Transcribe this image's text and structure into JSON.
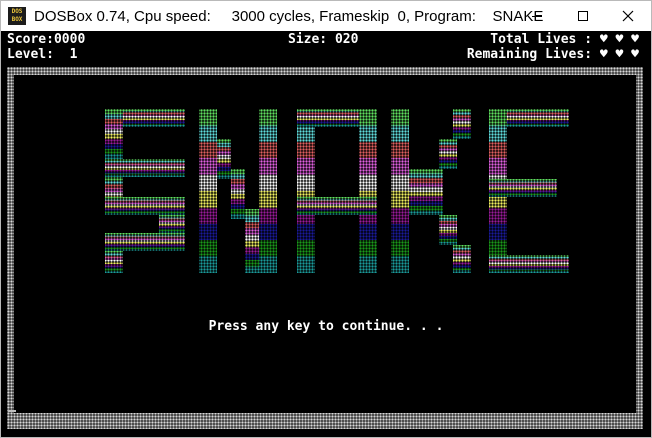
{
  "window": {
    "title": "DOSBox 0.74, Cpu speed:     3000 cycles, Frameskip  0, Program:    SNAKE",
    "app_icon_text": "DOS\nBOX",
    "buttons": {
      "minimize": "minimize-icon",
      "maximize": "maximize-icon",
      "close": "close-icon"
    }
  },
  "hud": {
    "score": "Score:0000",
    "level": "Level:  1",
    "size": "Size: 020",
    "total_lives": "Total Lives : ♥ ♥ ♥",
    "remaining_lives": "Remaining Lives: ♥ ♥ ♥"
  },
  "logo": {
    "letters": [
      "S",
      "N",
      "A",
      "K",
      "E"
    ],
    "band_colors": [
      "#5fe05f",
      "#5fdcdc",
      "#e05f5f",
      "#e05fe0",
      "#ffffff",
      "#f0f060",
      "#9a1a9a",
      "#1a1a9a",
      "#1a9a1a",
      "#1a9a9a"
    ]
  },
  "prompt": "Press any key to continue. . ."
}
